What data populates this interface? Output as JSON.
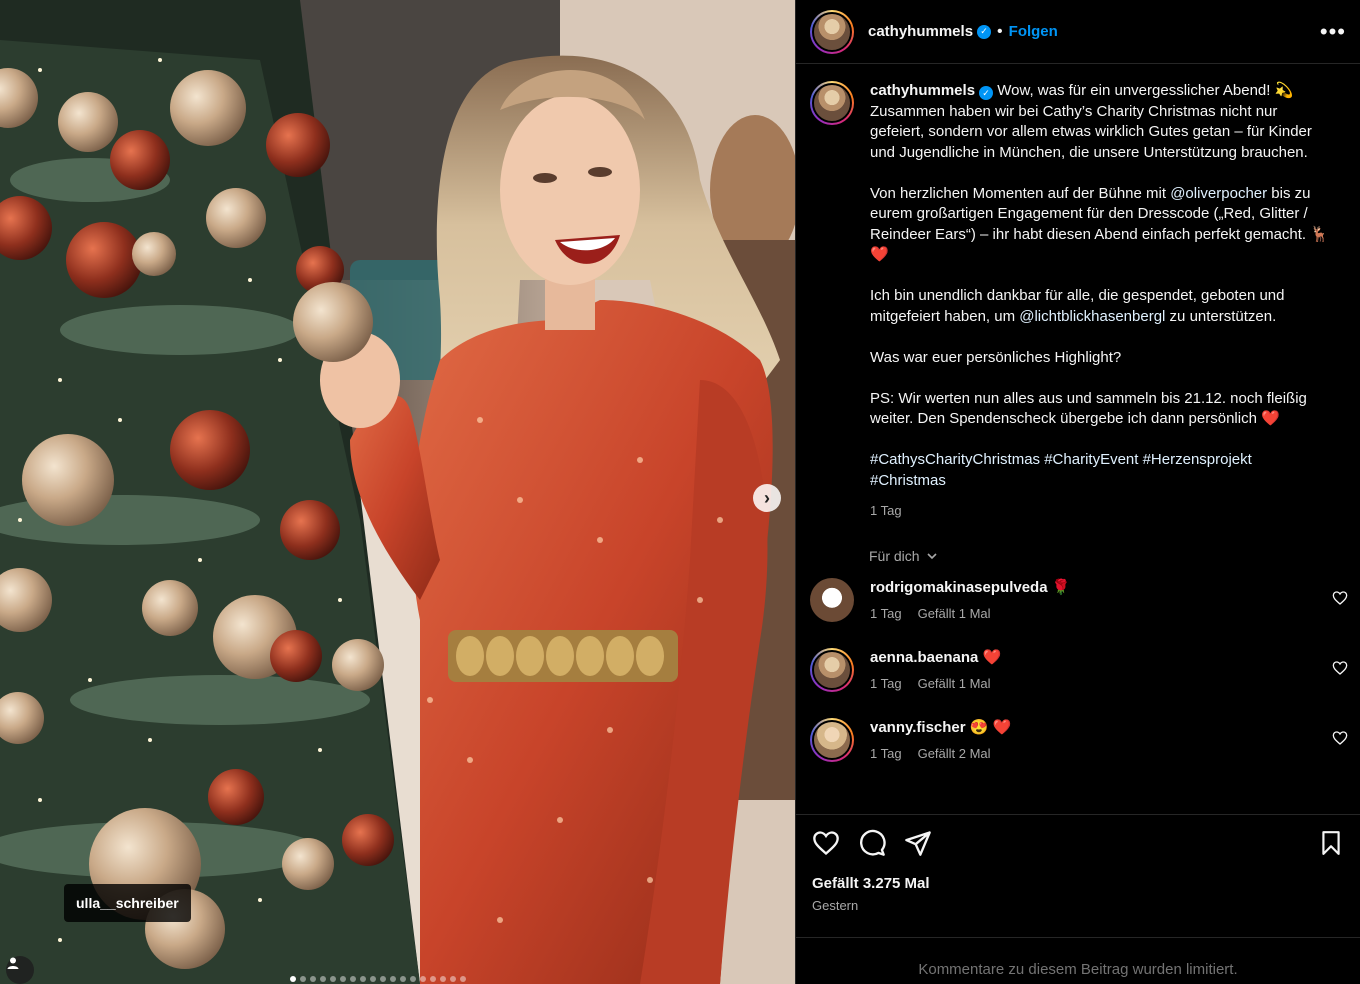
{
  "post": {
    "photo_tag": "ulla__schreiber",
    "carousel_count": 18,
    "carousel_active": 0
  },
  "header": {
    "username": "cathyhummels",
    "separator": "•",
    "follow_label": "Folgen",
    "more_label": "•••"
  },
  "caption": {
    "username": "cathyhummels",
    "p1": "Wow, was für ein unvergesslicher Abend! 💫 Zusammen haben wir bei Cathy’s Charity Christmas nicht nur gefeiert, sondern vor allem etwas wirklich Gutes getan – für Kinder und Jugendliche in München, die unsere Unterstützung brauchen.",
    "p2_before": "Von herzlichen Momenten auf der Bühne mit ",
    "p2_mention": "@oliverpocher",
    "p2_after": " bis zu eurem großartigen Engagement für den Dresscode („Red, Glitter / Reindeer Ears“) – ihr habt diesen Abend einfach perfekt gemacht. 🦌 ❤️",
    "p3_before": "Ich bin unendlich dankbar für alle, die gespendet, geboten und mitgefeiert haben, um ",
    "p3_mention": "@lichtblickhasenbergl",
    "p3_after": " zu unterstützen.",
    "p4": "Was war euer persönliches Highlight?",
    "p5": "PS: Wir werten nun alles aus und sammeln bis 21.12. noch fleißig weiter. Den Spendenscheck übergebe ich dann persönlich ❤️",
    "hashtags": "#CathysCharityChristmas #CharityEvent #Herzensprojekt #Christmas",
    "time": "1 Tag"
  },
  "fuer_dich": "Für dich",
  "comments": [
    {
      "user": "rodrigomakinasepulveda",
      "text": "🌹",
      "time": "1 Tag",
      "likes": "Gefällt 1 Mal"
    },
    {
      "user": "aenna.baenana",
      "text": "❤️",
      "time": "1 Tag",
      "likes": "Gefällt 1 Mal"
    },
    {
      "user": "vanny.fischer",
      "text": "😍 ❤️",
      "time": "1 Tag",
      "likes": "Gefällt 2 Mal"
    }
  ],
  "footer": {
    "likes": "Gefällt 3.275 Mal",
    "date": "Gestern",
    "limited": "Kommentare zu diesem Beitrag wurden limitiert."
  },
  "colors": {
    "accent_blue": "#0095f6",
    "heart_red": "#ff3040",
    "background": "#000000",
    "dress": "#c8442a"
  },
  "icons": [
    "next-icon",
    "user-tag-icon",
    "verified-icon",
    "more-icon",
    "heart-icon",
    "comment-icon",
    "share-icon",
    "bookmark-icon",
    "chevron-down-icon"
  ]
}
